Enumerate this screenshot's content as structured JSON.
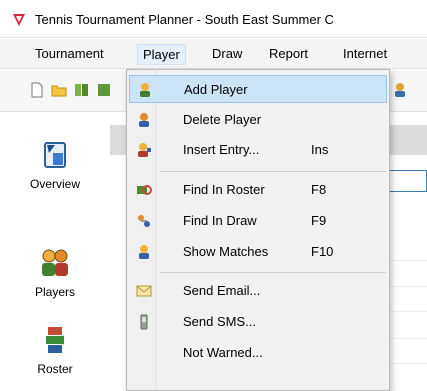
{
  "window": {
    "title": "Tennis Tournament Planner - South East Summer C"
  },
  "menubar": {
    "items": [
      {
        "label": "Tournament"
      },
      {
        "label": "Player"
      },
      {
        "label": "Draw"
      },
      {
        "label": "Report"
      },
      {
        "label": "Internet"
      }
    ]
  },
  "sidebar": {
    "items": [
      {
        "label": "Overview",
        "icon": "overview-icon"
      },
      {
        "label": "Players",
        "icon": "players-icon"
      },
      {
        "label": "Roster",
        "icon": "roster-icon"
      }
    ]
  },
  "player_menu": {
    "items": [
      {
        "label": "Add Player",
        "shortcut": "",
        "icon": "add-player-icon"
      },
      {
        "label": "Delete Player",
        "shortcut": "",
        "icon": "delete-player-icon"
      },
      {
        "label": "Insert Entry...",
        "shortcut": "Ins",
        "icon": "insert-entry-icon"
      },
      {
        "label": "Find In Roster",
        "shortcut": "F8",
        "icon": "find-roster-icon"
      },
      {
        "label": "Find In Draw",
        "shortcut": "F9",
        "icon": "find-draw-icon"
      },
      {
        "label": "Show Matches",
        "shortcut": "F10",
        "icon": "show-matches-icon"
      },
      {
        "label": "Send Email...",
        "shortcut": "",
        "icon": "email-icon"
      },
      {
        "label": "Send SMS...",
        "shortcut": "",
        "icon": "sms-icon"
      },
      {
        "label": "Not Warned...",
        "shortcut": "",
        "icon": ""
      }
    ]
  },
  "colors": {
    "highlight": "#cde4f7",
    "menu_background": "#f2f2f2",
    "accent_border": "#3c7fb1"
  }
}
